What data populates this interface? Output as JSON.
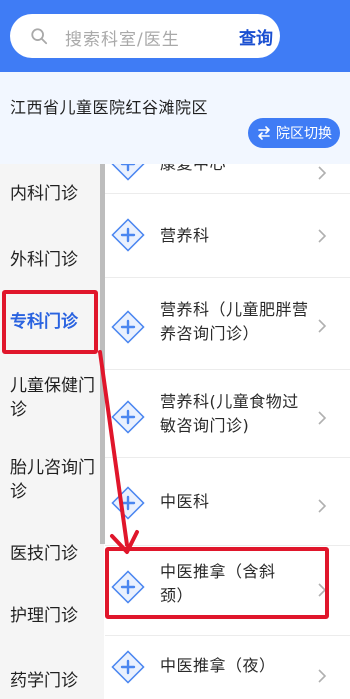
{
  "search": {
    "placeholder": "搜索科室/医生",
    "button": "查询",
    "icon": "search-icon"
  },
  "hospital": {
    "name": "江西省儿童医院红谷滩院区",
    "switch_label": "院区切换",
    "switch_icon": "swap-icon"
  },
  "sidebar": {
    "items": [
      {
        "label": "内科门诊",
        "active": false
      },
      {
        "label": "外科门诊",
        "active": false
      },
      {
        "label": "专科门诊",
        "active": true
      },
      {
        "label": "儿童保健门诊",
        "active": false
      },
      {
        "label": "胎儿咨询门诊",
        "active": false
      },
      {
        "label": "医技门诊",
        "active": false
      },
      {
        "label": "护理门诊",
        "active": false
      },
      {
        "label": "药学门诊",
        "active": false
      }
    ]
  },
  "departments": {
    "items": [
      {
        "label": "康复中心"
      },
      {
        "label": "营养科"
      },
      {
        "label": "营养科（儿童肥胖营养咨询门诊）"
      },
      {
        "label": "营养科(儿童食物过敏咨询门诊)"
      },
      {
        "label": "中医科"
      },
      {
        "label": "中医推拿（含斜颈）"
      },
      {
        "label": "中医推拿（夜）"
      }
    ],
    "row_icon": "department-cross-icon",
    "chevron_icon": "chevron-right-icon"
  },
  "colors": {
    "primary": "#3f7cf5",
    "highlight": "#e0162b",
    "active_text": "#2a63e0"
  }
}
